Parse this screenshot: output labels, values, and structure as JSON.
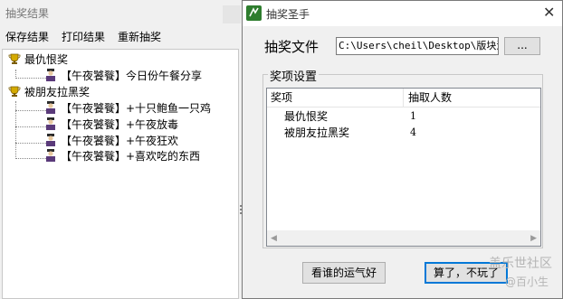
{
  "left_window": {
    "title": "抽奖结果",
    "menu": {
      "save": "保存结果",
      "print": "打印结果",
      "redraw": "重新抽奖"
    },
    "tree": [
      {
        "prize": "最仇恨奖",
        "winners": [
          "【午夜饕餮】今日份午餐分享"
        ]
      },
      {
        "prize": "被朋友拉黑奖",
        "winners": [
          "【午夜饕餮】+十只鲍鱼一只鸡",
          "【午夜饕餮】+午夜放毒",
          "【午夜饕餮】+午夜狂欢",
          "【午夜饕餮】+喜欢吃的东西"
        ]
      }
    ]
  },
  "right_window": {
    "title": "抽奖圣手",
    "close_glyph": "✕",
    "file_label": "抽奖文件",
    "file_path": "C:\\Users\\cheil\\Desktop\\版块活",
    "browse_label": "...",
    "group_label": "奖项设置",
    "columns": {
      "prize": "奖项",
      "count": "抽取人数"
    },
    "rows": [
      {
        "prize": "最仇恨奖",
        "count": "1"
      },
      {
        "prize": "被朋友拉黑奖",
        "count": "4"
      }
    ],
    "scroll_left": "◀",
    "scroll_right": "▶",
    "luck_button": "看谁的运气好",
    "quit_button": "算了，不玩了"
  },
  "watermark": {
    "line1": "盖乐世社区",
    "line2": "@百小生"
  },
  "colors": {
    "accent": "#0078d7",
    "app_icon": "#2e7d2e",
    "trophy": "#c8a000",
    "person": "#5a3a7a"
  }
}
